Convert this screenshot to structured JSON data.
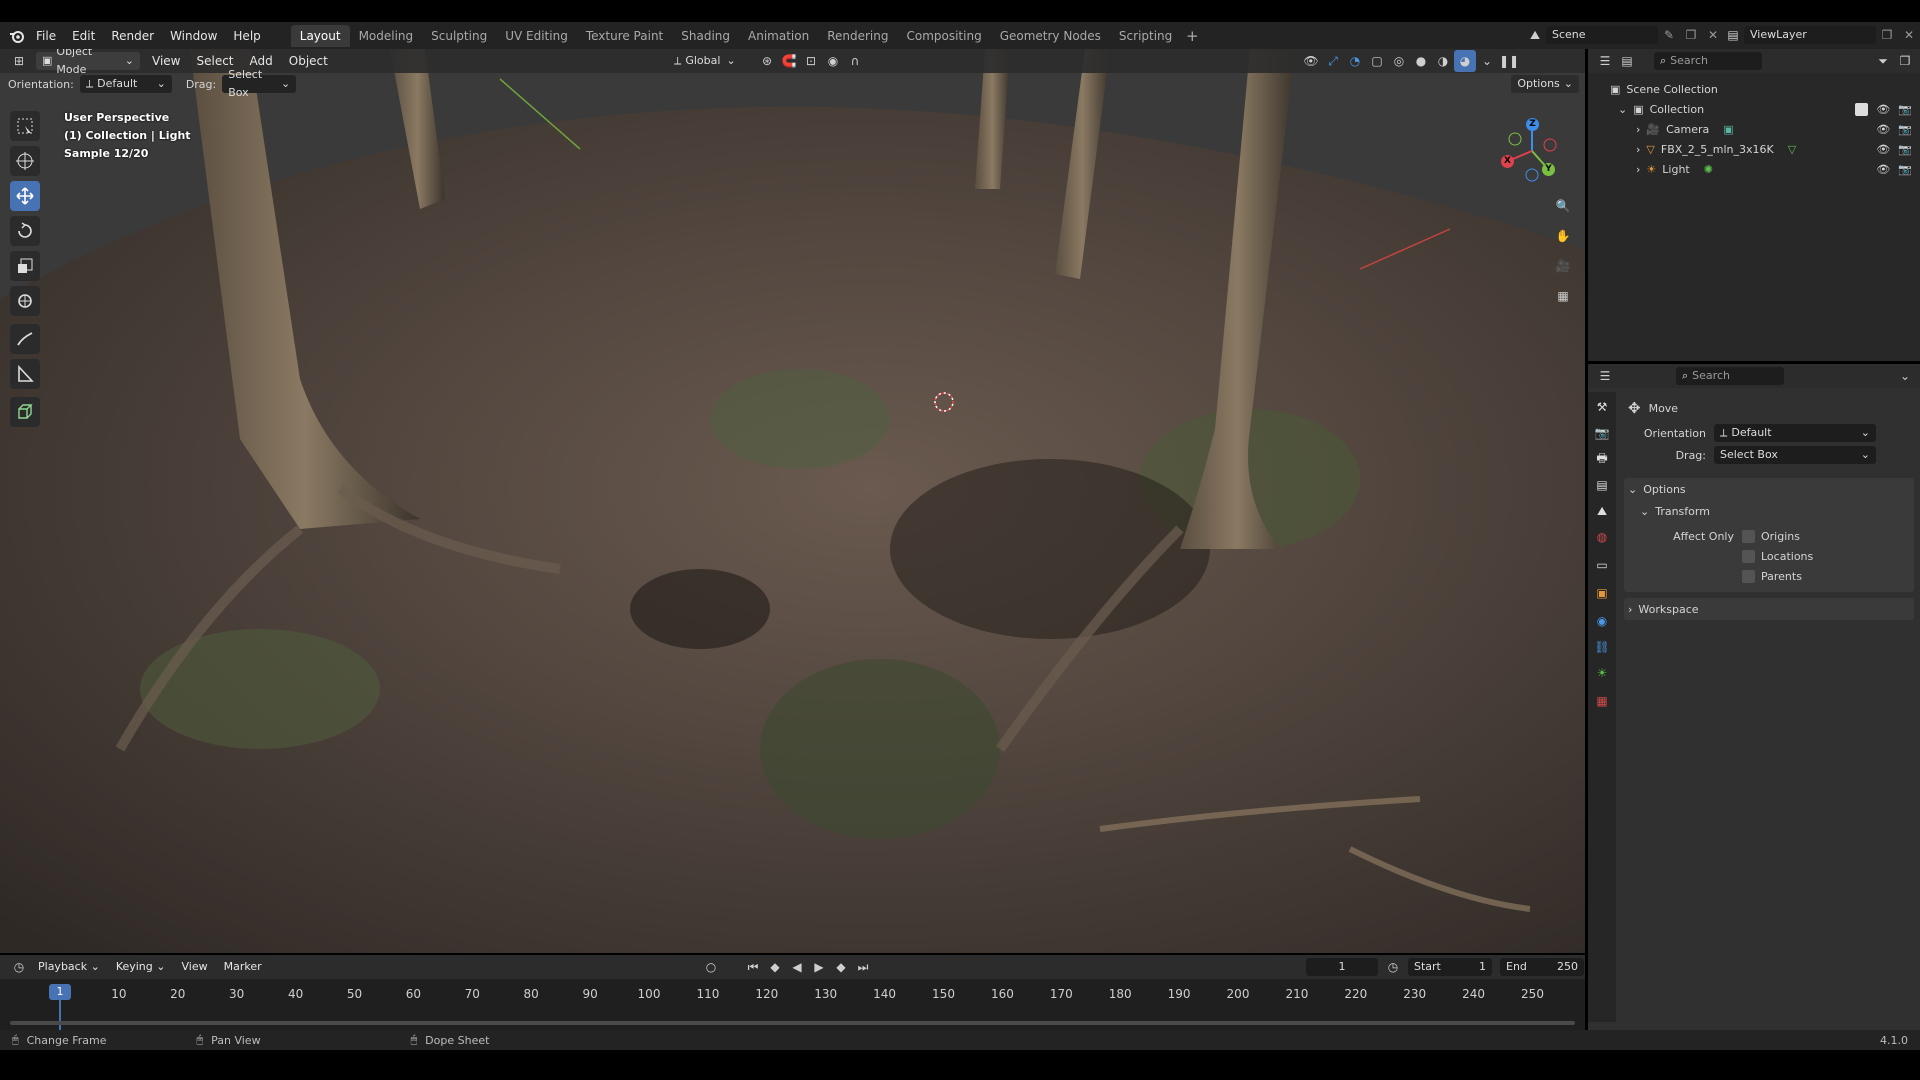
{
  "menus": [
    "File",
    "Edit",
    "Render",
    "Window",
    "Help"
  ],
  "workspaces": [
    "Layout",
    "Modeling",
    "Sculpting",
    "UV Editing",
    "Texture Paint",
    "Shading",
    "Animation",
    "Rendering",
    "Compositing",
    "Geometry Nodes",
    "Scripting"
  ],
  "active_workspace": "Layout",
  "scene_name": "Scene",
  "view_layer": "ViewLayer",
  "viewport_header": {
    "mode": "Object Mode",
    "menus": [
      "View",
      "Select",
      "Add",
      "Object"
    ],
    "transform_orientation": "Global",
    "options_label": "Options"
  },
  "tool_settings": {
    "orientation_label": "Orientation:",
    "orientation_value": "Default",
    "drag_label": "Drag:",
    "drag_value": "Select Box"
  },
  "overlay_text": {
    "line1": "User Perspective",
    "line2": "(1) Collection | Light",
    "line3": "Sample 12/20"
  },
  "gizmo": {
    "x": "X",
    "y": "Y",
    "z": "Z"
  },
  "outliner": {
    "search_placeholder": "Search",
    "root": "Scene Collection",
    "collection": "Collection",
    "items": [
      "Camera",
      "FBX_2_5_mln_3x16K",
      "Light"
    ]
  },
  "properties": {
    "search_placeholder": "Search",
    "tool_name": "Move",
    "orientation_label": "Orientation",
    "orientation_value": "Default",
    "drag_label": "Drag:",
    "drag_value": "Select Box",
    "options_label": "Options",
    "transform_label": "Transform",
    "affect_only_label": "Affect Only",
    "affect_options": [
      "Origins",
      "Locations",
      "Parents"
    ],
    "workspace_label": "Workspace"
  },
  "timeline": {
    "menus": [
      "Playback",
      "Keying",
      "View",
      "Marker"
    ],
    "current_frame": "1",
    "start_label": "Start",
    "start_value": "1",
    "end_label": "End",
    "end_value": "250",
    "ticks": [
      "10",
      "20",
      "30",
      "40",
      "50",
      "60",
      "70",
      "80",
      "90",
      "100",
      "110",
      "120",
      "130",
      "140",
      "150",
      "160",
      "170",
      "180",
      "190",
      "200",
      "210",
      "220",
      "230",
      "240",
      "250"
    ],
    "playhead_label": "1"
  },
  "statusbar": {
    "items": [
      "Change Frame",
      "Pan View",
      "Dope Sheet"
    ],
    "version": "4.1.0"
  },
  "colors": {
    "accent": "#4772b3",
    "axis_x": "#e0414d",
    "axis_y": "#7ac142",
    "axis_z": "#3d8eea"
  }
}
